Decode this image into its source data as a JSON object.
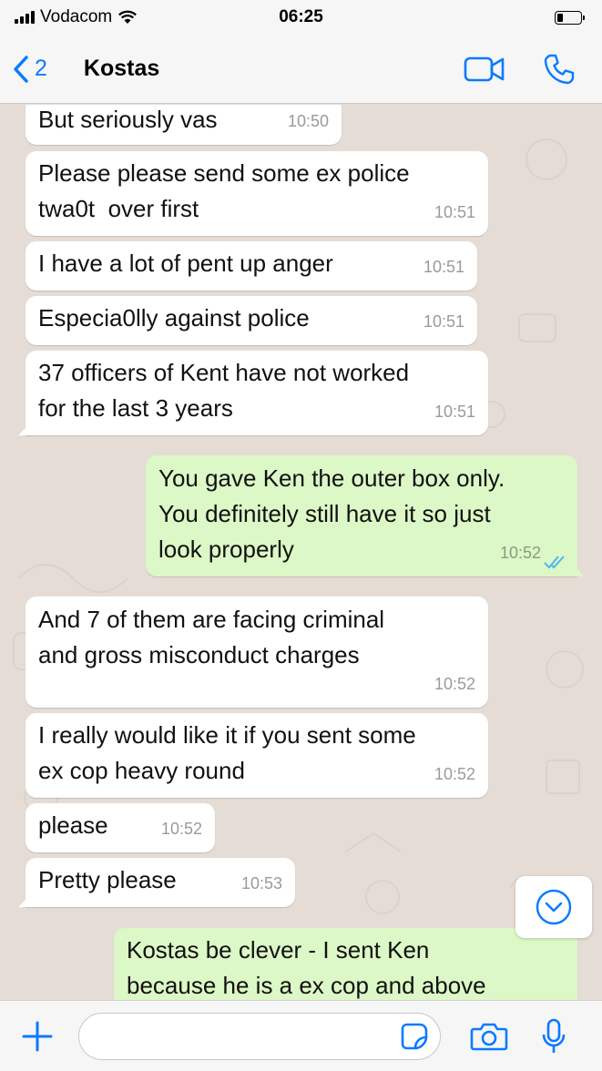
{
  "status_bar": {
    "carrier": "Vodacom",
    "time": "06:25",
    "battery_level": 0.25
  },
  "header": {
    "back_count": "2",
    "contact_name": "Kostas",
    "icons": [
      "chevron-left-icon",
      "video-call-icon",
      "phone-icon"
    ]
  },
  "messages": [
    {
      "direction": "in",
      "text": "But seriously vas",
      "time": "10:50"
    },
    {
      "direction": "in",
      "text": "Please please send some ex police\ntwa0t  over first",
      "time": "10:51"
    },
    {
      "direction": "in",
      "text": "I have a lot of pent up anger",
      "time": "10:51"
    },
    {
      "direction": "in",
      "text": "Especia0lly against police",
      "time": "10:51"
    },
    {
      "direction": "in",
      "text": "37 officers of Kent have not worked\nfor the last 3 years",
      "time": "10:51"
    },
    {
      "direction": "out",
      "text": "You gave Ken the outer box only.\nYou definitely still have it so just\nlook properly",
      "time": "10:52",
      "read": true
    },
    {
      "direction": "in",
      "text": "And 7 of them are facing criminal\nand gross misconduct charges",
      "time": "10:52"
    },
    {
      "direction": "in",
      "text": "I really would like it if you sent some\nex cop heavy round",
      "time": "10:52"
    },
    {
      "direction": "in",
      "text": "please",
      "time": "10:52"
    },
    {
      "direction": "in",
      "text": "Pretty please",
      "time": "10:53"
    },
    {
      "direction": "out",
      "text": "Kostas be clever - I sent Ken\nbecause he is a ex cop and above",
      "time": ""
    }
  ],
  "input": {
    "placeholder": "",
    "icons": [
      "plus-icon",
      "sticker-icon",
      "camera-icon",
      "microphone-icon"
    ]
  },
  "colors": {
    "accent": "#0a7aff",
    "incoming": "#ffffff",
    "outgoing": "#dcf8c6",
    "background": "#e5ddd5"
  }
}
